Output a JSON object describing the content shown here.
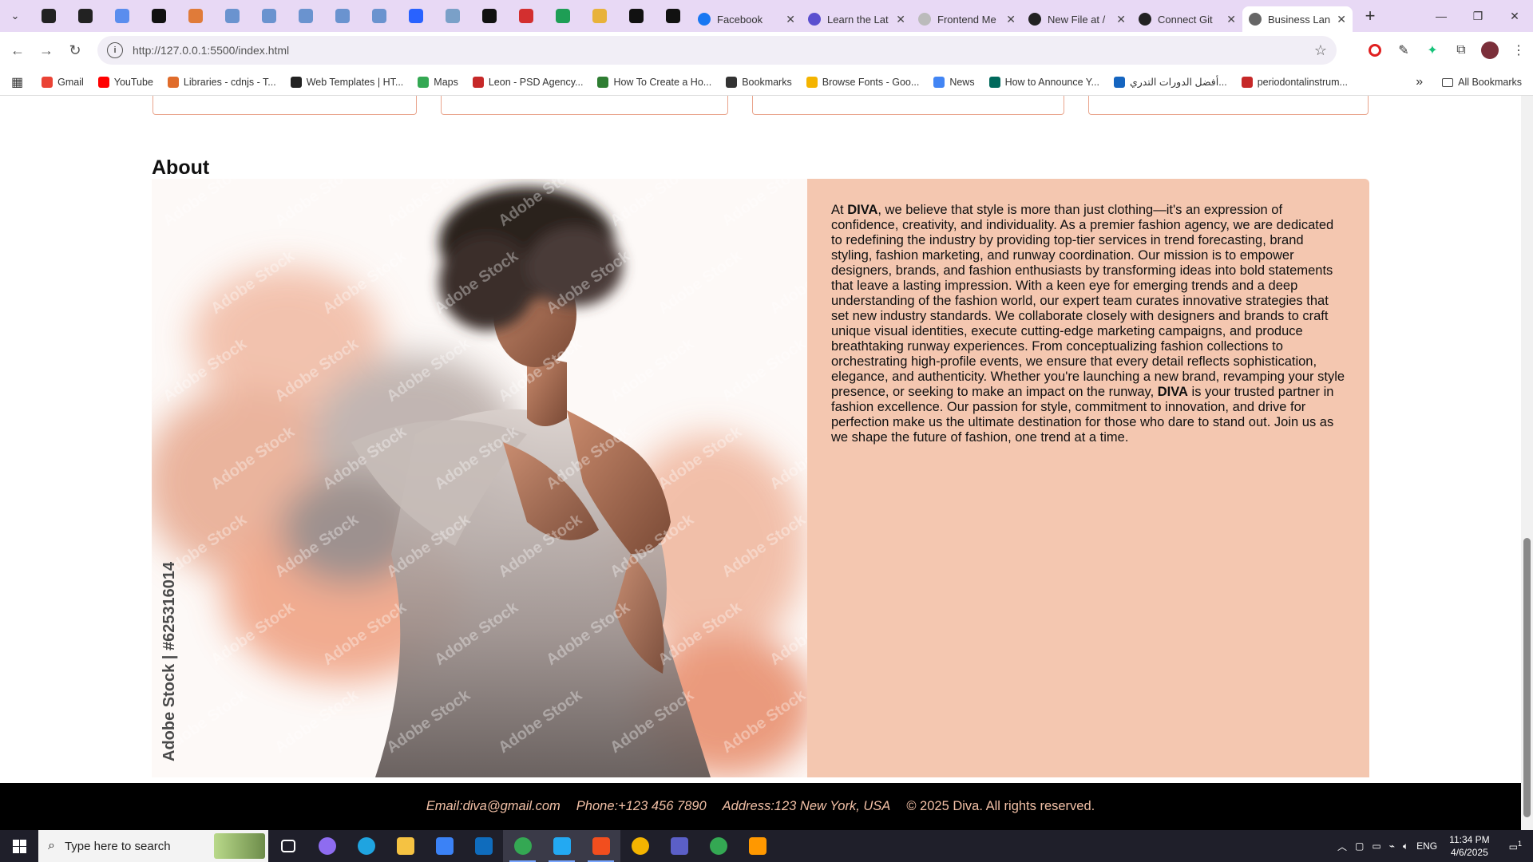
{
  "browser": {
    "tabs": [
      {
        "title": "Facebook",
        "color": "#1877f2"
      },
      {
        "title": "Learn the Lat",
        "color": "#5a4fcf"
      },
      {
        "title": "Frontend Me",
        "color": "#bbbbbb"
      },
      {
        "title": "New File at /",
        "color": "#222222"
      },
      {
        "title": "Connect Git",
        "color": "#222222"
      },
      {
        "title": "Business Lan",
        "color": "#666666"
      }
    ],
    "active_tab_index": 5,
    "pinned_tab_colors": [
      "#222222",
      "#222222",
      "#5a8dee",
      "#111111",
      "#e07b39",
      "#6a93cf",
      "#6a93cf",
      "#6a93cf",
      "#6a93cf",
      "#6a93cf",
      "#2962ff",
      "#7aa0c8",
      "#111111",
      "#d32f2f",
      "#1e9e55",
      "#e8b23a",
      "#111111",
      "#111111"
    ],
    "url": "http://127.0.0.1:5500/index.html",
    "new_tab_label": "+",
    "window_controls": [
      "—",
      "❐",
      "✕"
    ]
  },
  "bookmarks": {
    "items": [
      {
        "label": "Gmail",
        "color": "#ea4335"
      },
      {
        "label": "YouTube",
        "color": "#ff0000"
      },
      {
        "label": "Libraries - cdnjs - T...",
        "color": "#e06c2b"
      },
      {
        "label": "Web Templates | HT...",
        "color": "#222222"
      },
      {
        "label": "Maps",
        "color": "#34a853"
      },
      {
        "label": "Leon - PSD Agency...",
        "color": "#c62828"
      },
      {
        "label": "How To Create a Ho...",
        "color": "#2e7d32"
      },
      {
        "label": "Bookmarks",
        "color": "#333333"
      },
      {
        "label": "Browse Fonts - Goo...",
        "color": "#f4b400"
      },
      {
        "label": "News",
        "color": "#4285f4"
      },
      {
        "label": "How to Announce Y...",
        "color": "#00695c"
      },
      {
        "label": "أفضل الدورات التدري...",
        "color": "#1565c0"
      },
      {
        "label": "periodontalinstrum...",
        "color": "#c62828"
      }
    ],
    "more_label": "»",
    "all_bookmarks_label": "All Bookmarks"
  },
  "page": {
    "about_title": "About",
    "about_paragraph": [
      {
        "text": "At ",
        "bold": false
      },
      {
        "text": "DIVA",
        "bold": true
      },
      {
        "text": ", we believe that style is more than just clothing—it's an expression of confidence, creativity, and individuality. As a premier fashion agency, we are dedicated to redefining the industry by providing top-tier services in trend forecasting, brand styling, fashion marketing, and runway coordination. Our mission is to empower designers, brands, and fashion enthusiasts by transforming ideas into bold statements that leave a lasting impression. With a keen eye for emerging trends and a deep understanding of the fashion world, our expert team curates innovative strategies that set new industry standards. We collaborate closely with designers and brands to craft unique visual identities, execute cutting-edge marketing campaigns, and produce breathtaking runway experiences. From conceptualizing fashion collections to orchestrating high-profile events, we ensure that every detail reflects sophistication, elegance, and authenticity. Whether you're launching a new brand, revamping your style presence, or seeking to make an impact on the runway, ",
        "bold": false
      },
      {
        "text": "DIVA",
        "bold": true
      },
      {
        "text": " is your trusted partner in fashion excellence. Our passion for style, commitment to innovation, and drive for perfection make us the ultimate destination for those who dare to stand out. Join us as we shape the future of fashion, one trend at a time.",
        "bold": false
      }
    ],
    "hero_watermark": "Adobe Stock | #625316014",
    "hero_tile_watermark": "Adobe Stock",
    "footer": {
      "email": "Email:diva@gmail.com",
      "phone": "Phone:+123 456 7890",
      "address": "Address:123 New York, USA",
      "copyright": "© 2025 Diva. All rights reserved."
    },
    "colors": {
      "about_bg": "#f4c7b0",
      "footer_text": "#f2c0a6",
      "card_border": "#e9a48c"
    }
  },
  "taskbar": {
    "search_placeholder": "Type here to search",
    "apps": [
      {
        "name": "task-view",
        "color": "#ffffff"
      },
      {
        "name": "copilot",
        "color": "#8e6cf0"
      },
      {
        "name": "edge",
        "color": "#1fa4e0"
      },
      {
        "name": "file-explorer",
        "color": "#f5c242"
      },
      {
        "name": "store",
        "color": "#3b82f6"
      },
      {
        "name": "outlook",
        "color": "#0f6cbd"
      },
      {
        "name": "chrome",
        "color": "#34a853"
      },
      {
        "name": "vscode",
        "color": "#23a9f2"
      },
      {
        "name": "figma",
        "color": "#f24e1e"
      },
      {
        "name": "chrome-canary",
        "color": "#f4b400"
      },
      {
        "name": "teams",
        "color": "#5b5fc7"
      },
      {
        "name": "chrome-2",
        "color": "#34a853"
      },
      {
        "name": "sublime",
        "color": "#ff9800"
      }
    ],
    "active_apps": [
      6,
      7,
      8
    ],
    "language": "ENG",
    "time": "11:34 PM",
    "date": "4/6/2025",
    "notification_count": "1"
  }
}
